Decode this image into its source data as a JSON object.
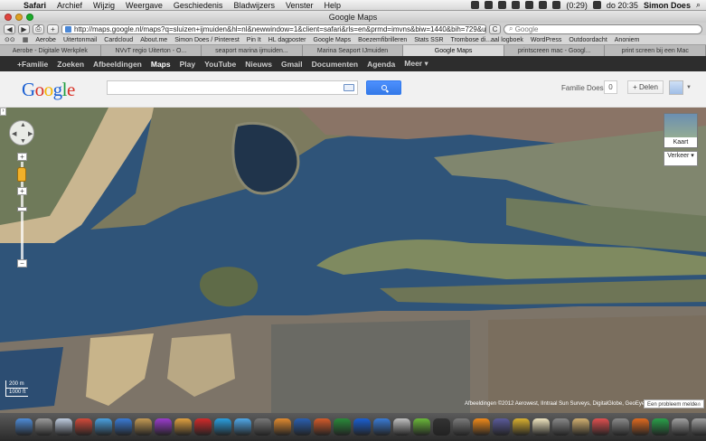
{
  "menubar": {
    "apple": "",
    "items": [
      "Safari",
      "Archief",
      "Wijzig",
      "Weergave",
      "Geschiedenis",
      "Bladwijzers",
      "Venster",
      "Help"
    ],
    "battery": "(0:29)",
    "clock": "do 20:35",
    "user": "Simon Does"
  },
  "window": {
    "title": "Google Maps"
  },
  "toolbar": {
    "back": "◀",
    "forward": "▶",
    "add": "+",
    "url": "http://maps.google.nl/maps?q=sluizen+ijmuiden&hl=nl&newwindow=1&client=safari&rls=en&prmd=imvns&biw=1440&bih=729&um=1&i",
    "reload": "C",
    "search_placeholder": "Google"
  },
  "bookmarks": [
    "Aerobe",
    "Uitertonmail",
    "Cardcloud",
    "About.me",
    "Simon Does / Pinterest",
    "Pin It",
    "HL dagposter",
    "Google Maps",
    "Boezemfibrilleren",
    "Stats SSR",
    "Trombose di...aal logboek",
    "WordPress",
    "Outdoordacht",
    "Anoniem"
  ],
  "tabs": [
    {
      "label": "Aerobe - Digitale Werkplek",
      "active": false
    },
    {
      "label": "NVvT regio Uiterton - O...",
      "active": false
    },
    {
      "label": "seaport marina ijmuiden...",
      "active": false
    },
    {
      "label": "Marina Seaport IJmuiden",
      "active": false
    },
    {
      "label": "Google Maps",
      "active": true
    },
    {
      "label": "printscreen mac - Googl...",
      "active": false
    },
    {
      "label": "print screen bij een Mac",
      "active": false
    }
  ],
  "gnav": [
    "+Familie",
    "Zoeken",
    "Afbeeldingen",
    "Maps",
    "Play",
    "YouTube",
    "Nieuws",
    "Gmail",
    "Documenten",
    "Agenda",
    "Meer ▾"
  ],
  "gnav_active": "Maps",
  "header": {
    "logo_letters": [
      {
        "ch": "G",
        "color": "#1a5fd2"
      },
      {
        "ch": "o",
        "color": "#d93025"
      },
      {
        "ch": "o",
        "color": "#f4b400"
      },
      {
        "ch": "g",
        "color": "#1a5fd2"
      },
      {
        "ch": "l",
        "color": "#1f9d3f"
      },
      {
        "ch": "e",
        "color": "#d93025"
      }
    ],
    "search_value": "",
    "user_name": "Familie Does",
    "notif_count": "0",
    "share_label": "+ Delen"
  },
  "map": {
    "collapse": "›",
    "maptype_label": "Kaart",
    "traffic_label": "Verkeer ▾",
    "scale_m": "200 m",
    "scale_ft": "1000 ft",
    "attribution": "Afbeeldingen ©2012 Aerowest, IIntraal Sun Surveys, DigitalGlobe, GeoEye,",
    "report": "Een probleem melden",
    "report_close": "x",
    "zoom_in": "+",
    "zoom_out": "−"
  },
  "dock": {
    "icons": [
      {
        "name": "finder-icon",
        "color": "#4e8cd8"
      },
      {
        "name": "launchpad-icon",
        "color": "#9a9a9a"
      },
      {
        "name": "mail-icon",
        "color": "#bfcde0"
      },
      {
        "name": "ical-icon",
        "color": "#d24a3a"
      },
      {
        "name": "safari-icon",
        "color": "#4aa0e0"
      },
      {
        "name": "app-store-icon",
        "color": "#3a7bd5"
      },
      {
        "name": "photo-icon",
        "color": "#c49a54"
      },
      {
        "name": "itunes-icon",
        "color": "#9a3ccc"
      },
      {
        "name": "preview-icon",
        "color": "#e0a040"
      },
      {
        "name": "hema-icon",
        "color": "#d22a2a"
      },
      {
        "name": "skype-icon",
        "color": "#2a9fe0"
      },
      {
        "name": "messages-icon",
        "color": "#50a8e8"
      },
      {
        "name": "pen-icon",
        "color": "#777"
      },
      {
        "name": "quill-icon",
        "color": "#e08a30"
      },
      {
        "name": "word-icon",
        "color": "#2a5fb0"
      },
      {
        "name": "powerpoint-icon",
        "color": "#d45a2a"
      },
      {
        "name": "excel-icon",
        "color": "#2a8a3a"
      },
      {
        "name": "syncmate-icon",
        "color": "#1a5fd2"
      },
      {
        "name": "editor-icon",
        "color": "#3a7bd5"
      },
      {
        "name": "printer-icon",
        "color": "#c0c0c0"
      },
      {
        "name": "evernote-icon",
        "color": "#6ab83a"
      },
      {
        "name": "terminal-icon",
        "color": "#333"
      },
      {
        "name": "network-icon",
        "color": "#7a7a7a"
      },
      {
        "name": "vlc-icon",
        "color": "#f08a1a"
      },
      {
        "name": "vmware-icon",
        "color": "#5a5a9a"
      },
      {
        "name": "chrome-icon",
        "color": "#d9b030"
      },
      {
        "name": "notes-icon",
        "color": "#f0e6c0"
      },
      {
        "name": "calculator-icon",
        "color": "#888"
      },
      {
        "name": "contacts-icon",
        "color": "#d2b070"
      },
      {
        "name": "color-icon",
        "color": "#e05050"
      },
      {
        "name": "gear-icon",
        "color": "#8a8a8a"
      },
      {
        "name": "firefox-icon",
        "color": "#e06a20"
      },
      {
        "name": "greenapp-icon",
        "color": "#2aa04a"
      },
      {
        "name": "disk-icon",
        "color": "#a0a0a0"
      },
      {
        "name": "disk-icon",
        "color": "#a0a0a0"
      },
      {
        "name": "disk-icon",
        "color": "#a0a0a0"
      },
      {
        "name": "disk-icon",
        "color": "#a0a0a0"
      },
      {
        "name": "folder-icon",
        "color": "#6fa0d8"
      },
      {
        "name": "folder-icon",
        "color": "#6fa0d8"
      },
      {
        "name": "folder-icon",
        "color": "#6fa0d8"
      },
      {
        "name": "trash-icon",
        "color": "#b0b0b0"
      }
    ]
  }
}
